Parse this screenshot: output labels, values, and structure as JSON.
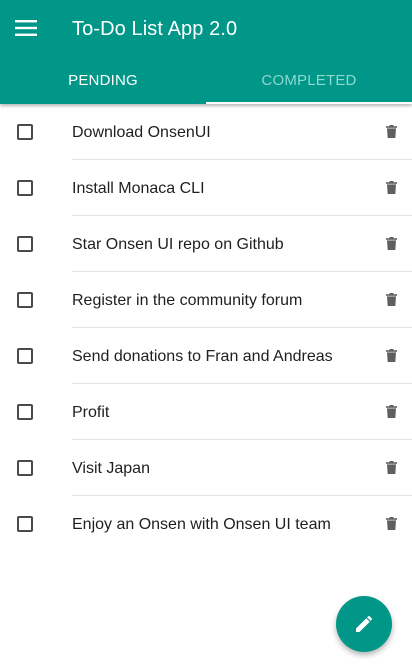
{
  "app": {
    "title": "To-Do List App 2.0",
    "accent_color": "#009688"
  },
  "toolbar": {
    "menu_icon": "hamburger-menu-icon"
  },
  "tabs": [
    {
      "label": "PENDING",
      "active": true
    },
    {
      "label": "COMPLETED",
      "active": false
    }
  ],
  "tasks": [
    {
      "label": "Download OnsenUI",
      "checked": false
    },
    {
      "label": "Install Monaca CLI",
      "checked": false
    },
    {
      "label": "Star Onsen UI repo on Github",
      "checked": false
    },
    {
      "label": "Register in the community forum",
      "checked": false
    },
    {
      "label": "Send donations to Fran and Andreas",
      "checked": false
    },
    {
      "label": "Profit",
      "checked": false
    },
    {
      "label": "Visit Japan",
      "checked": false
    },
    {
      "label": "Enjoy an Onsen with Onsen UI team",
      "checked": false
    }
  ],
  "task_actions": {
    "delete_icon": "trash-icon"
  },
  "fab": {
    "icon": "pencil-icon"
  }
}
